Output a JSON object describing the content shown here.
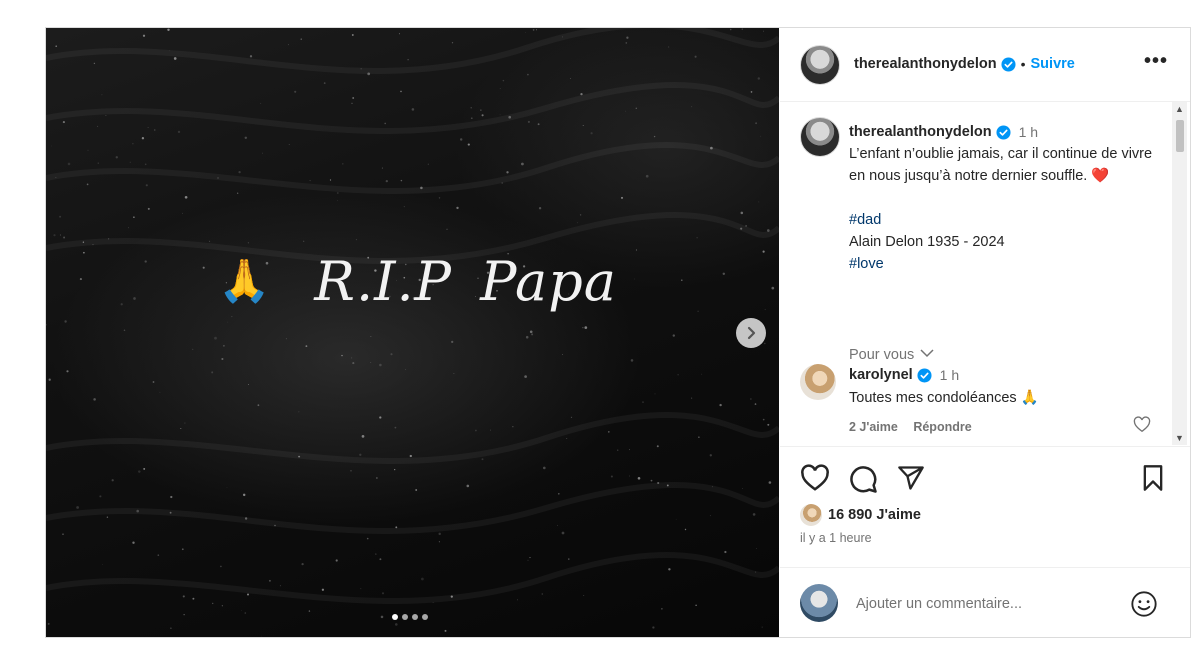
{
  "post": {
    "image_text": "R.I.P  Papa",
    "image_emoji": "🙏",
    "carousel": {
      "count": 4,
      "active": 0
    }
  },
  "header": {
    "username": "therealanthonydelon",
    "separator": "•",
    "follow_label": "Suivre",
    "more_label": "•••"
  },
  "caption": {
    "username": "therealanthonydelon",
    "time": "1 h",
    "text": "L’enfant n’oublie jamais, car il continue de vivre en nous jusqu’à notre dernier souffle.",
    "heart": "❤️",
    "hashtag1": "#dad",
    "line2": "Alain Delon 1935 - 2024",
    "hashtag2": "#love"
  },
  "pour_vous": "Pour vous",
  "comment": {
    "username": "karolynel",
    "time": "1 h",
    "text": "Toutes mes condoléances",
    "emoji": "🙏",
    "likes": "2 J'aime",
    "reply": "Répondre"
  },
  "likes": "16 890 J'aime",
  "posted_ago": "il y a 1 heure",
  "add_comment": {
    "placeholder": "Ajouter un commentaire..."
  },
  "colors": {
    "accent": "#0095f6",
    "hashtag": "#00376b",
    "muted": "#737373",
    "heart": "#ed4956"
  }
}
